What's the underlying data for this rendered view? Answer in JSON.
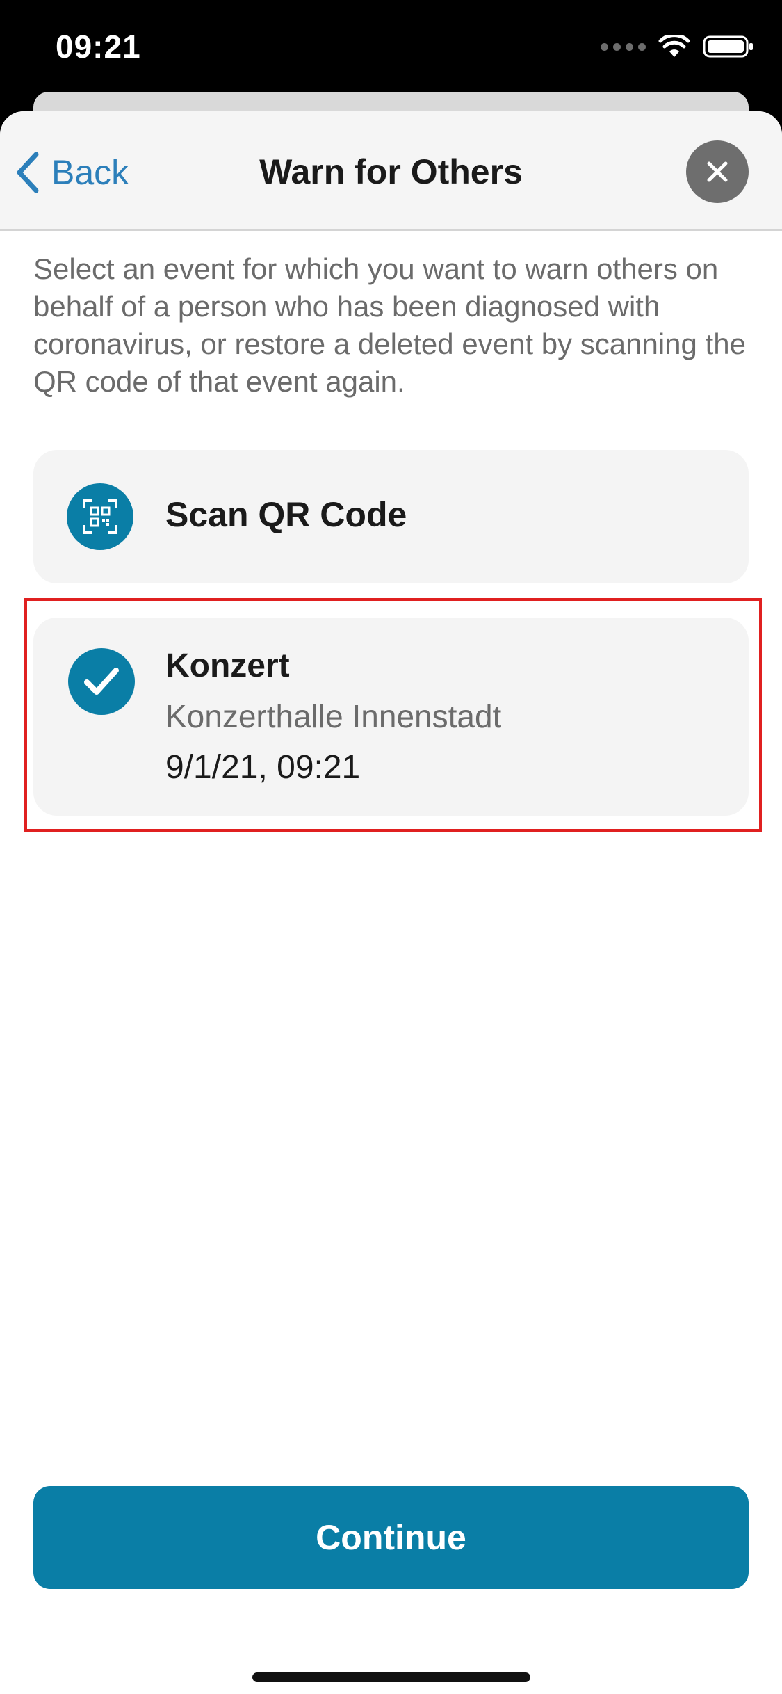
{
  "status_bar": {
    "time": "09:21"
  },
  "nav": {
    "back_label": "Back",
    "title": "Warn for Others"
  },
  "description": "Select an event for which you want to warn others on behalf of a person who has been diagnosed with coronavirus, or restore a deleted event by scanning the QR code of that event again.",
  "scan_option": {
    "label": "Scan QR Code",
    "icon": "qr-code-scan-icon"
  },
  "event": {
    "title": "Konzert",
    "location": "Konzerthalle Innenstadt",
    "datetime": "9/1/21, 09:21",
    "selected": true,
    "icon": "checkmark-icon"
  },
  "continue_label": "Continue",
  "colors": {
    "accent": "#0a7ea6",
    "link": "#2c7fba",
    "highlight": "#e02020",
    "card_bg": "#f4f4f4"
  }
}
